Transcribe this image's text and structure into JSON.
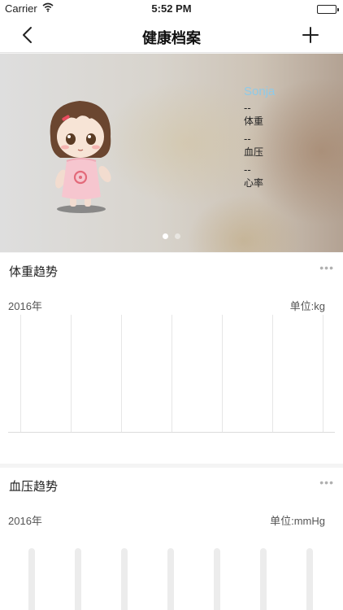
{
  "status_bar": {
    "carrier": "Carrier",
    "time": "5:52 PM"
  },
  "nav": {
    "title": "健康档案"
  },
  "profile": {
    "name": "Sonja",
    "weight_value": "--",
    "weight_label": "体重",
    "bp_value": "--",
    "bp_label": "血压",
    "heart_value": "--",
    "heart_label": "心率"
  },
  "weight_card": {
    "title": "体重趋势",
    "more": "•••",
    "year": "2016年",
    "unit": "单位:kg"
  },
  "bp_card": {
    "title": "血压趋势",
    "more": "•••",
    "year": "2016年",
    "unit": "单位:mmHg"
  },
  "colors": {
    "accent_name": "#8ecae8",
    "background": "#f4f4f4"
  }
}
